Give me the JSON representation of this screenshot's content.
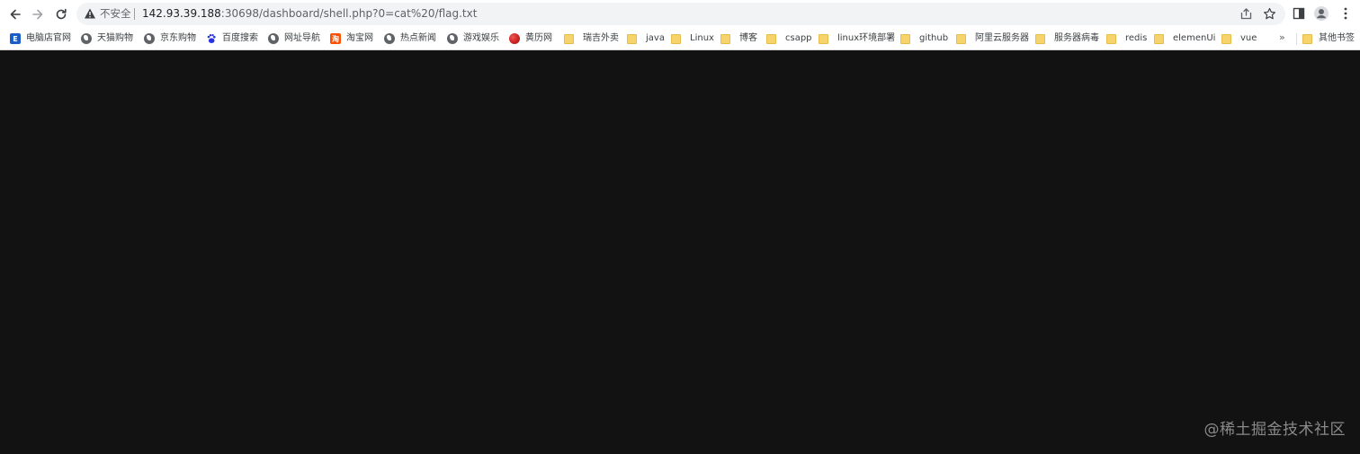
{
  "browser": {
    "address_bar": {
      "security_label": "不安全",
      "url_host": "142.93.39.188",
      "url_rest": ":30698/dashboard/shell.php?0=cat%20/flag.txt"
    },
    "nav": {
      "back_icon": "arrow-left-icon",
      "forward_icon": "arrow-right-icon",
      "reload_icon": "reload-icon"
    },
    "toolbar_icons": [
      "share-icon",
      "star-icon",
      "side-panel-icon",
      "profile-icon",
      "more-vert-icon"
    ],
    "bookmarks": [
      {
        "label": "电脑店官网",
        "icon": "site-logo-icon"
      },
      {
        "label": "天猫购物",
        "icon": "globe-icon"
      },
      {
        "label": "京东购物",
        "icon": "globe-icon"
      },
      {
        "label": "百度搜索",
        "icon": "baidu-paw-icon"
      },
      {
        "label": "网址导航",
        "icon": "globe-icon"
      },
      {
        "label": "淘宝网",
        "icon": "taobao-icon"
      },
      {
        "label": "热点新闻",
        "icon": "globe-icon"
      },
      {
        "label": "游戏娱乐",
        "icon": "globe-icon"
      },
      {
        "label": "黄历网",
        "icon": "yinyang-icon"
      },
      {
        "label": "瑞吉外卖",
        "icon": "folder-icon"
      },
      {
        "label": "java",
        "icon": "folder-icon"
      },
      {
        "label": "Linux",
        "icon": "folder-icon"
      },
      {
        "label": "博客",
        "icon": "folder-icon"
      },
      {
        "label": "csapp",
        "icon": "folder-icon"
      },
      {
        "label": "linux环境部署",
        "icon": "folder-icon"
      },
      {
        "label": "github",
        "icon": "folder-icon"
      },
      {
        "label": "阿里云服务器",
        "icon": "folder-icon"
      },
      {
        "label": "服务器病毒",
        "icon": "folder-icon"
      },
      {
        "label": "redis",
        "icon": "folder-icon"
      },
      {
        "label": "elemenUi",
        "icon": "folder-icon"
      },
      {
        "label": "vue",
        "icon": "folder-icon"
      }
    ],
    "overflow_label": "»",
    "other_bookmarks": {
      "label": "其他书签",
      "icon": "folder-icon"
    }
  },
  "page": {
    "background": "#121212",
    "watermark": "@稀土掘金技术社区"
  },
  "colors": {
    "folder": "#f6d36b",
    "chrome_bg": "#ffffff",
    "omnibox_bg": "#f1f3f4"
  }
}
